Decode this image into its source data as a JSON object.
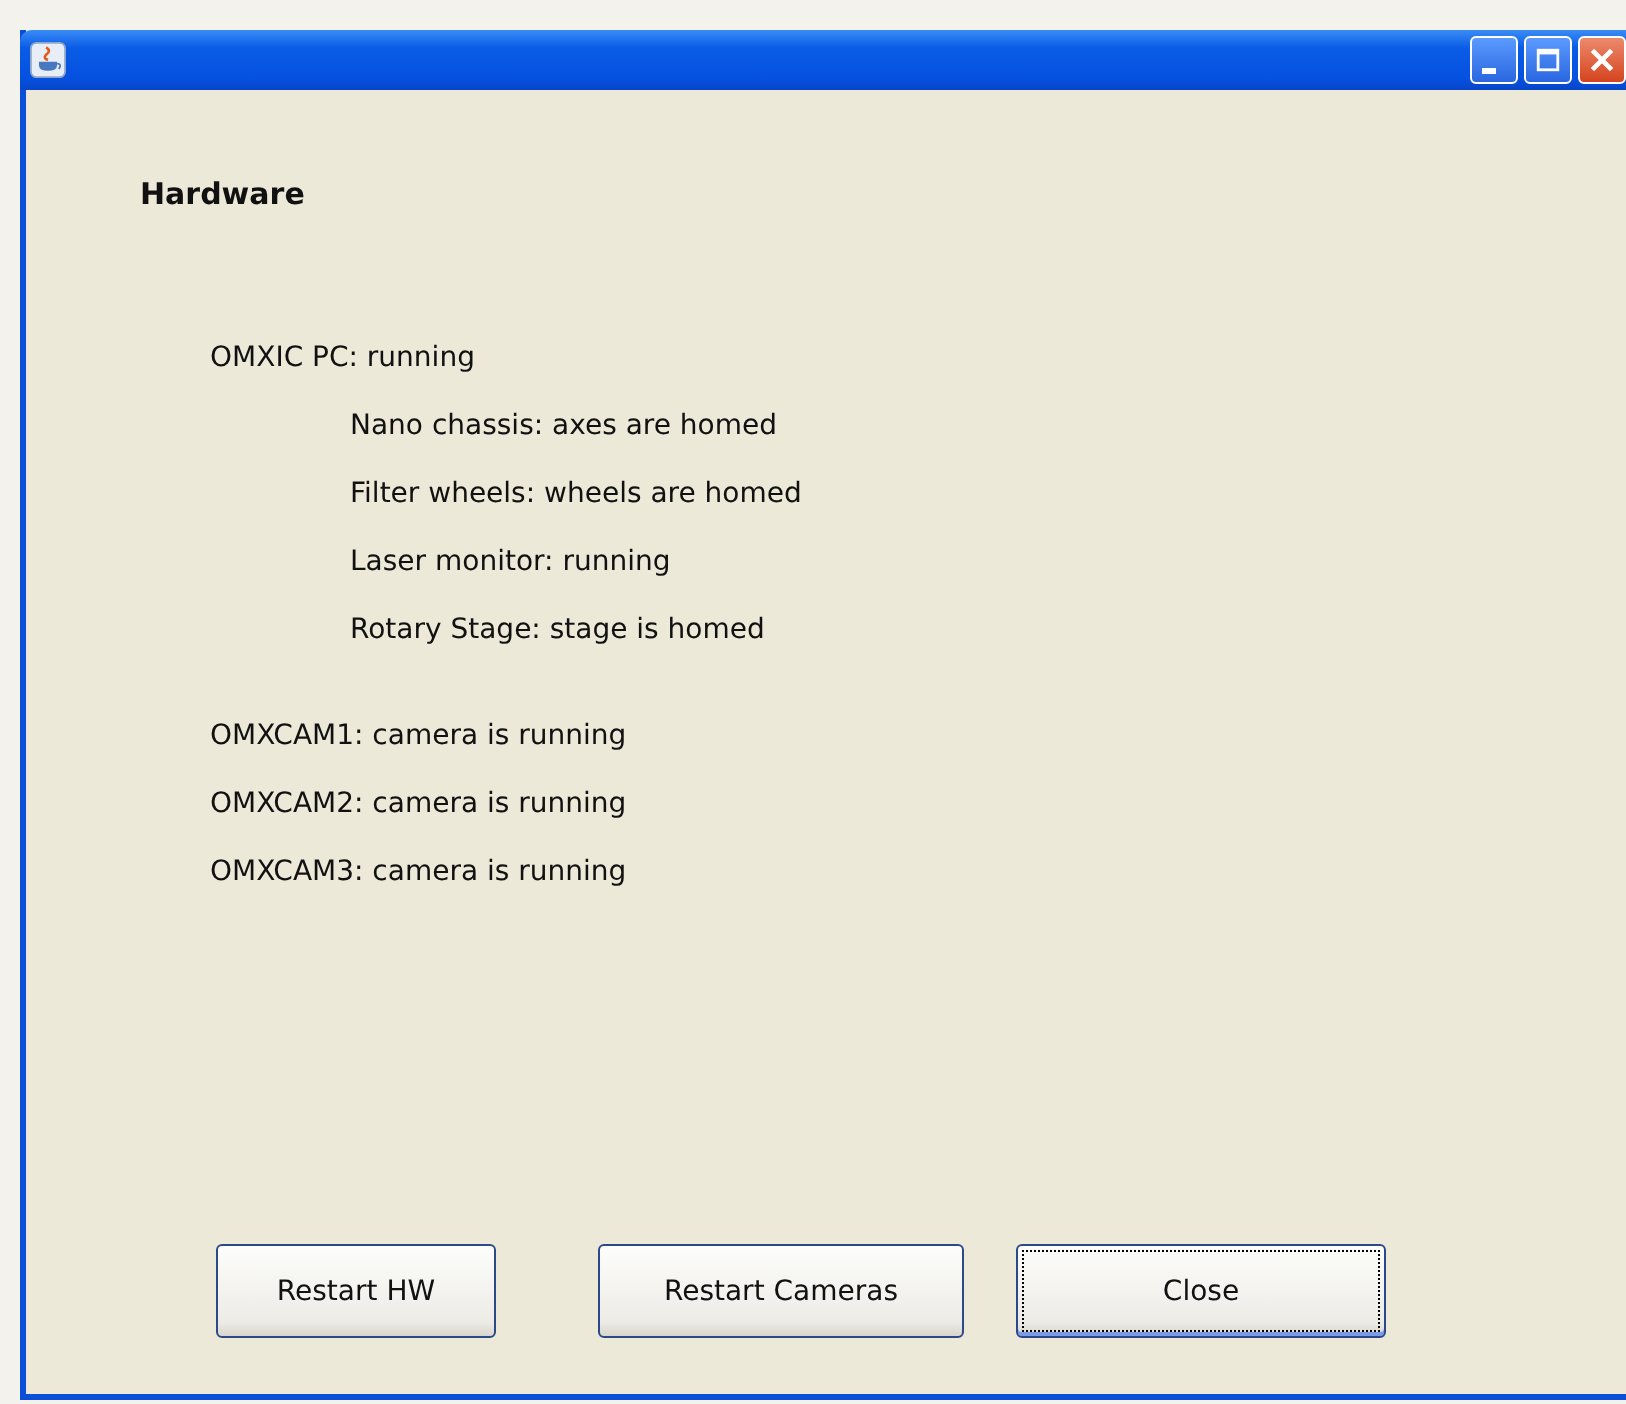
{
  "window": {
    "title_buttons": [
      {
        "kind": "minimize"
      },
      {
        "kind": "maximize"
      },
      {
        "kind": "close"
      }
    ]
  },
  "heading": "Hardware",
  "groups": [
    {
      "items": [
        {
          "label": "OMXIC PC: running",
          "children": [
            {
              "label": "Nano chassis: axes are homed"
            },
            {
              "label": "Filter wheels: wheels are homed"
            },
            {
              "label": "Laser monitor: running"
            },
            {
              "label": "Rotary Stage: stage is homed"
            }
          ]
        }
      ]
    },
    {
      "items": [
        {
          "label": "OMXCAM1: camera is running"
        },
        {
          "label": "OMXCAM2: camera is running"
        },
        {
          "label": "OMXCAM3: camera is running"
        }
      ]
    }
  ],
  "buttons": [
    {
      "label": "Restart HW",
      "focused": false
    },
    {
      "label": "Restart Cameras",
      "focused": false
    },
    {
      "label": "Close",
      "focused": true
    }
  ]
}
